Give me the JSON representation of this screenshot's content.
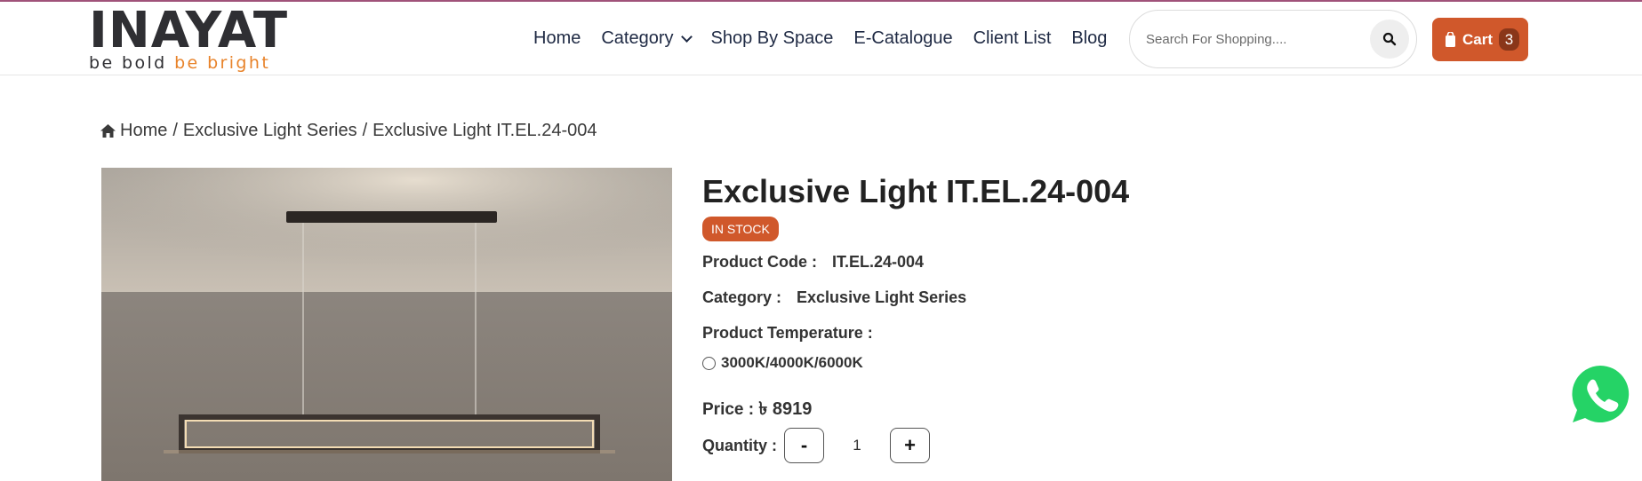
{
  "brand": {
    "name": "INAYAT",
    "tagline_part1": "be bold",
    "tagline_part2": "be bright",
    "accent_color": "#e8832a"
  },
  "nav": {
    "items": [
      {
        "label": "Home"
      },
      {
        "label": "Category"
      },
      {
        "label": "Shop By Space"
      },
      {
        "label": "E-Catalogue"
      },
      {
        "label": "Client List"
      },
      {
        "label": "Blog"
      }
    ]
  },
  "search": {
    "placeholder": "Search For Shopping...."
  },
  "cart": {
    "label": "Cart",
    "count": "3",
    "color": "#d0582b"
  },
  "breadcrumb": {
    "home": "Home",
    "sep": "/",
    "category": "Exclusive Light Series",
    "current": "Exclusive Light IT.EL.24-004"
  },
  "product": {
    "title": "Exclusive Light IT.EL.24-004",
    "stock": "IN STOCK",
    "code_label": "Product Code :",
    "code": "IT.EL.24-004",
    "category_label": "Category :",
    "category": "Exclusive Light Series",
    "temperature_label": "Product Temperature :",
    "temperature_option": "3000K/4000K/6000K",
    "price_label": "Price :",
    "price": "৳ 8919",
    "quantity_label": "Quantity :",
    "quantity": "1",
    "minus": "-",
    "plus": "+"
  },
  "icons": {
    "home": "home-icon",
    "search": "search-icon",
    "cart": "shopping-bag-icon",
    "chat": "whatsapp-icon"
  }
}
